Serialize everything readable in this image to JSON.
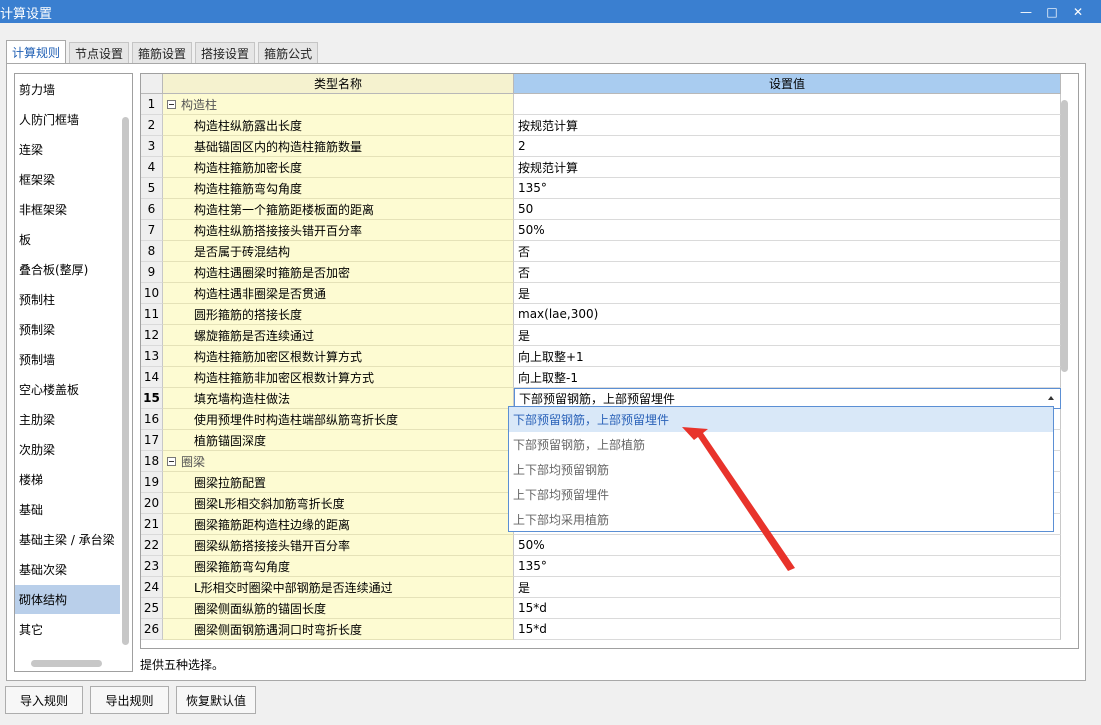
{
  "window": {
    "title": "计算设置",
    "min_icon": "minimize-icon",
    "max_icon": "maximize-icon",
    "close_icon": "close-icon"
  },
  "tabs": [
    {
      "label": "计算规则",
      "active": true
    },
    {
      "label": "节点设置",
      "active": false
    },
    {
      "label": "箍筋设置",
      "active": false
    },
    {
      "label": "搭接设置",
      "active": false
    },
    {
      "label": "箍筋公式",
      "active": false
    }
  ],
  "sidebar": {
    "items": [
      "剪力墙",
      "人防门框墙",
      "连梁",
      "框架梁",
      "非框架梁",
      "板",
      "叠合板(整厚)",
      "预制柱",
      "预制梁",
      "预制墙",
      "空心楼盖板",
      "主肋梁",
      "次肋梁",
      "楼梯",
      "基础",
      "基础主梁 / 承台梁",
      "基础次梁",
      "砌体结构",
      "其它"
    ],
    "active": "砌体结构"
  },
  "grid": {
    "header": {
      "name": "类型名称",
      "value": "设置值"
    },
    "rows": [
      {
        "num": "1",
        "name": "构造柱",
        "value": "",
        "group": true
      },
      {
        "num": "2",
        "name": "构造柱纵筋露出长度",
        "value": "按规范计算"
      },
      {
        "num": "3",
        "name": "基础锚固区内的构造柱箍筋数量",
        "value": "2"
      },
      {
        "num": "4",
        "name": "构造柱箍筋加密长度",
        "value": "按规范计算"
      },
      {
        "num": "5",
        "name": "构造柱箍筋弯勾角度",
        "value": "135°"
      },
      {
        "num": "6",
        "name": "构造柱第一个箍筋距楼板面的距离",
        "value": "50"
      },
      {
        "num": "7",
        "name": "构造柱纵筋搭接接头错开百分率",
        "value": "50%"
      },
      {
        "num": "8",
        "name": "是否属于砖混结构",
        "value": "否"
      },
      {
        "num": "9",
        "name": "构造柱遇圈梁时箍筋是否加密",
        "value": "否"
      },
      {
        "num": "10",
        "name": "构造柱遇非圈梁是否贯通",
        "value": "是"
      },
      {
        "num": "11",
        "name": "圆形箍筋的搭接长度",
        "value": "max(lae,300)"
      },
      {
        "num": "12",
        "name": "螺旋箍筋是否连续通过",
        "value": "是"
      },
      {
        "num": "13",
        "name": "构造柱箍筋加密区根数计算方式",
        "value": "向上取整+1"
      },
      {
        "num": "14",
        "name": "构造柱箍筋非加密区根数计算方式",
        "value": "向上取整-1"
      },
      {
        "num": "15",
        "name": "填充墙构造柱做法",
        "value": "下部预留钢筋，上部预留埋件",
        "selected": true
      },
      {
        "num": "16",
        "name": "使用预埋件时构造柱端部纵筋弯折长度",
        "value": ""
      },
      {
        "num": "17",
        "name": "植筋锚固深度",
        "value": ""
      },
      {
        "num": "18",
        "name": "圈梁",
        "value": "",
        "group": true
      },
      {
        "num": "19",
        "name": "圈梁拉筋配置",
        "value": ""
      },
      {
        "num": "20",
        "name": "圈梁L形相交斜加筋弯折长度",
        "value": ""
      },
      {
        "num": "21",
        "name": "圈梁箍筋距构造柱边缘的距离",
        "value": ""
      },
      {
        "num": "22",
        "name": "圈梁纵筋搭接接头错开百分率",
        "value": "50%"
      },
      {
        "num": "23",
        "name": "圈梁箍筋弯勾角度",
        "value": "135°"
      },
      {
        "num": "24",
        "name": "L形相交时圈梁中部钢筋是否连续通过",
        "value": "是"
      },
      {
        "num": "25",
        "name": "圈梁侧面纵筋的锚固长度",
        "value": "15*d"
      },
      {
        "num": "26",
        "name": "圈梁侧面钢筋遇洞口时弯折长度",
        "value": "15*d"
      }
    ],
    "dropdown_options": [
      "下部预留钢筋，上部预留埋件",
      "下部预留钢筋，上部植筋",
      "上下部均预留钢筋",
      "上下部均预留埋件",
      "上下部均采用植筋"
    ]
  },
  "description": "提供五种选择。",
  "buttons": {
    "import": "导入规则",
    "export": "导出规则",
    "restore": "恢复默认值"
  },
  "colors": {
    "titlebar": "#3a7fd0",
    "arrow": "#e8332b",
    "value_header": "#a9ccf0",
    "name_column": "#fdfbd2"
  }
}
